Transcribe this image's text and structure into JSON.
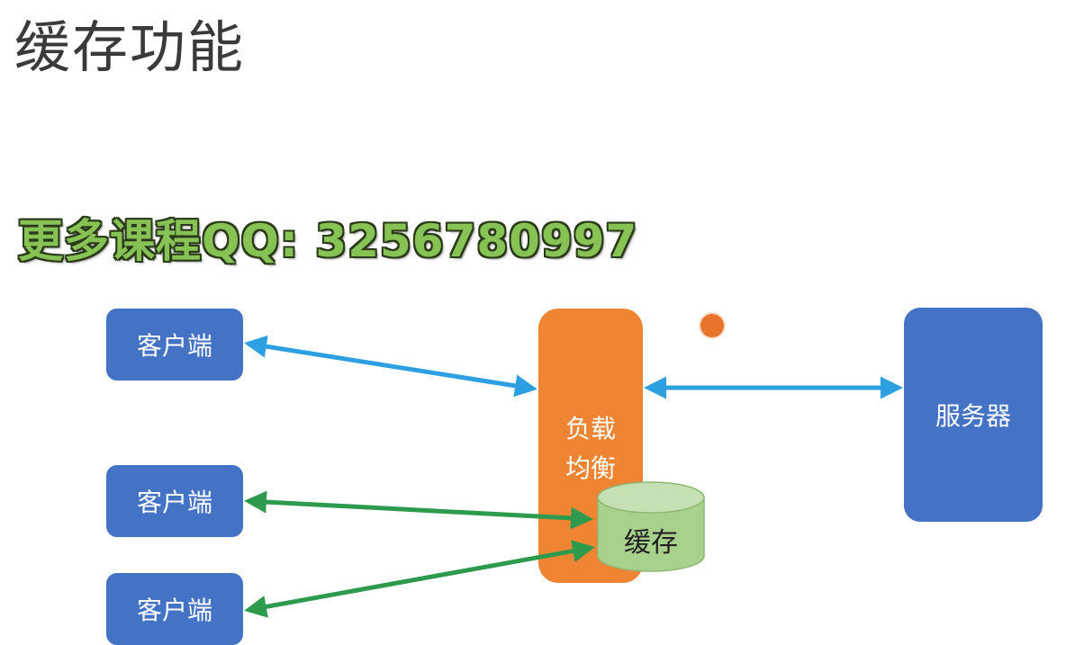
{
  "title": "缓存功能",
  "watermark": "更多课程QQ: 3256780997",
  "nodes": {
    "client_1": "客户端",
    "client_2": "客户端",
    "client_3": "客户端",
    "load_balancer": "负载均衡",
    "cache": "缓存",
    "server": "服务器"
  },
  "colors": {
    "box_blue": "#4472c4",
    "load_balancer_orange": "#ef8533",
    "cache_green": "#a9d18e",
    "arrow_blue": "#2e9fe0",
    "arrow_green": "#2e9a4e",
    "watermark_green": "#86c254"
  },
  "edges": [
    {
      "from": "client_1",
      "to": "load_balancer",
      "bidirectional": true,
      "color": "arrow_blue"
    },
    {
      "from": "load_balancer",
      "to": "server",
      "bidirectional": true,
      "color": "arrow_blue"
    },
    {
      "from": "client_2",
      "to": "cache",
      "bidirectional": true,
      "color": "arrow_green"
    },
    {
      "from": "client_3",
      "to": "cache",
      "bidirectional": true,
      "color": "arrow_green"
    }
  ]
}
